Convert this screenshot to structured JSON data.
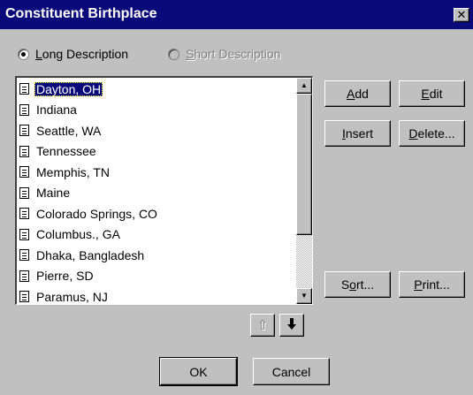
{
  "window": {
    "title": "Constituent Birthplace",
    "close_glyph": "✕"
  },
  "options": {
    "long": {
      "label_hotkey": "L",
      "label_rest": "ong Description",
      "selected": true,
      "enabled": true
    },
    "short": {
      "label_hotkey": "S",
      "label_rest": "hort Description",
      "selected": false,
      "enabled": false
    }
  },
  "list": {
    "items": [
      "Dayton, OH",
      "Indiana",
      "Seattle, WA",
      "Tennessee",
      "Memphis, TN",
      "Maine",
      "Colorado Springs, CO",
      "Columbus., GA",
      "Dhaka, Bangladesh",
      "Pierre, SD",
      "Paramus, NJ"
    ],
    "selected_index": 0,
    "item_icon": "document-icon",
    "scroll": {
      "up_glyph": "▲",
      "down_glyph": "▼"
    }
  },
  "buttons": {
    "add": {
      "hotkey": "A",
      "rest": "dd"
    },
    "edit": {
      "hotkey": "E",
      "rest": "dit"
    },
    "insert": {
      "hotkey": "I",
      "rest": "nsert"
    },
    "delete": {
      "hotkey": "D",
      "rest": "elete..."
    },
    "sort": {
      "pre": "S",
      "hotkey": "o",
      "rest": "rt..."
    },
    "print": {
      "hotkey": "P",
      "rest": "rint..."
    },
    "ok": "OK",
    "cancel": "Cancel",
    "move_up": {
      "glyph": "⇧",
      "enabled": false
    },
    "move_down": {
      "glyph": "🡇",
      "enabled": true
    }
  }
}
